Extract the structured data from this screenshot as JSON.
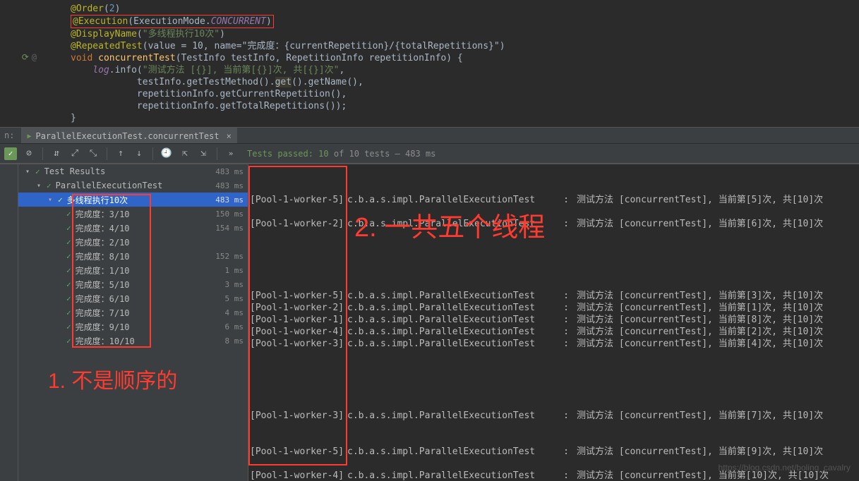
{
  "code": {
    "order_anno": "@Order",
    "order_val": "2",
    "exec_anno": "@Execution",
    "exec_arg_prefix": "ExecutionMode.",
    "exec_arg_mode": "CONCURRENT",
    "display_anno": "@DisplayName",
    "display_val": "\"多线程执行10次\"",
    "repeat_anno": "@RepeatedTest",
    "repeat_args": "(value = 10, name=\"完成度：{currentRepetition}/{totalRepetitions}\")",
    "ret": "void",
    "method": "concurrentTest",
    "params": "(TestInfo testInfo, RepetitionInfo repetitionInfo) {",
    "log_obj": "log",
    "log_call": ".info(",
    "log_fmt": "\"测试方法 [{}], 当前第[{}]次, 共[{}]次\"",
    "line_a": "testInfo.getTestMethod().",
    "line_a_get": "get",
    "line_a_tail": "().getName(),",
    "line_b": "repetitionInfo.getCurrentRepetition(),",
    "line_c": "repetitionInfo.getTotalRepetitions());",
    "close": "}"
  },
  "tab": {
    "prefix": "n:",
    "name": "ParallelExecutionTest.concurrentTest"
  },
  "toolbar": {
    "status_prefix": "Tests passed:",
    "status_count": "10",
    "status_suffix": "of 10 tests – 483 ms"
  },
  "tree": {
    "root": "Test Results",
    "root_ms": "483 ms",
    "class": "ParallelExecutionTest",
    "class_ms": "483 ms",
    "group": "多线程执行10次",
    "group_ms": "483 ms",
    "items": [
      {
        "label": "完成度：3/10",
        "ms": "150 ms"
      },
      {
        "label": "完成度：4/10",
        "ms": "154 ms"
      },
      {
        "label": "完成度：2/10",
        "ms": ""
      },
      {
        "label": "完成度：8/10",
        "ms": "152 ms"
      },
      {
        "label": "完成度：1/10",
        "ms": "1 ms"
      },
      {
        "label": "完成度：5/10",
        "ms": "3 ms"
      },
      {
        "label": "完成度：6/10",
        "ms": "5 ms"
      },
      {
        "label": "完成度：7/10",
        "ms": "4 ms"
      },
      {
        "label": "完成度：9/10",
        "ms": "6 ms"
      },
      {
        "label": "完成度：10/10",
        "ms": "8 ms"
      }
    ]
  },
  "console": {
    "logger": "c.b.a.s.impl.ParallelExecutionTest",
    "lines": [
      {
        "w": "[Pool-1-worker-5]",
        "m": "测试方法 [concurrentTest], 当前第[5]次, 共[10]次"
      },
      {
        "blank": true
      },
      {
        "w": "[Pool-1-worker-2]",
        "m": "测试方法 [concurrentTest], 当前第[6]次, 共[10]次"
      },
      {
        "blank": true
      },
      {
        "blank": true
      },
      {
        "blank": true
      },
      {
        "blank": true
      },
      {
        "blank": true
      },
      {
        "w": "[Pool-1-worker-5]",
        "m": "测试方法 [concurrentTest], 当前第[3]次, 共[10]次"
      },
      {
        "w": "[Pool-1-worker-2]",
        "m": "测试方法 [concurrentTest], 当前第[1]次, 共[10]次"
      },
      {
        "w": "[Pool-1-worker-1]",
        "m": "测试方法 [concurrentTest], 当前第[8]次, 共[10]次"
      },
      {
        "w": "[Pool-1-worker-4]",
        "m": "测试方法 [concurrentTest], 当前第[2]次, 共[10]次"
      },
      {
        "w": "[Pool-1-worker-3]",
        "m": "测试方法 [concurrentTest], 当前第[4]次, 共[10]次"
      },
      {
        "blank": true
      },
      {
        "blank": true
      },
      {
        "blank": true
      },
      {
        "blank": true
      },
      {
        "blank": true
      },
      {
        "w": "[Pool-1-worker-3]",
        "m": "测试方法 [concurrentTest], 当前第[7]次, 共[10]次"
      },
      {
        "blank": true
      },
      {
        "blank": true
      },
      {
        "w": "[Pool-1-worker-5]",
        "m": "测试方法 [concurrentTest], 当前第[9]次, 共[10]次"
      },
      {
        "blank": true
      },
      {
        "w": "[Pool-1-worker-4]",
        "m": "测试方法 [concurrentTest], 当前第[10]次, 共[10]次"
      }
    ]
  },
  "annotations": {
    "note1": "1. 不是顺序的",
    "note2": "2. 一共五个线程"
  },
  "watermark": "https://blog.csdn.net/boling_cavalry"
}
